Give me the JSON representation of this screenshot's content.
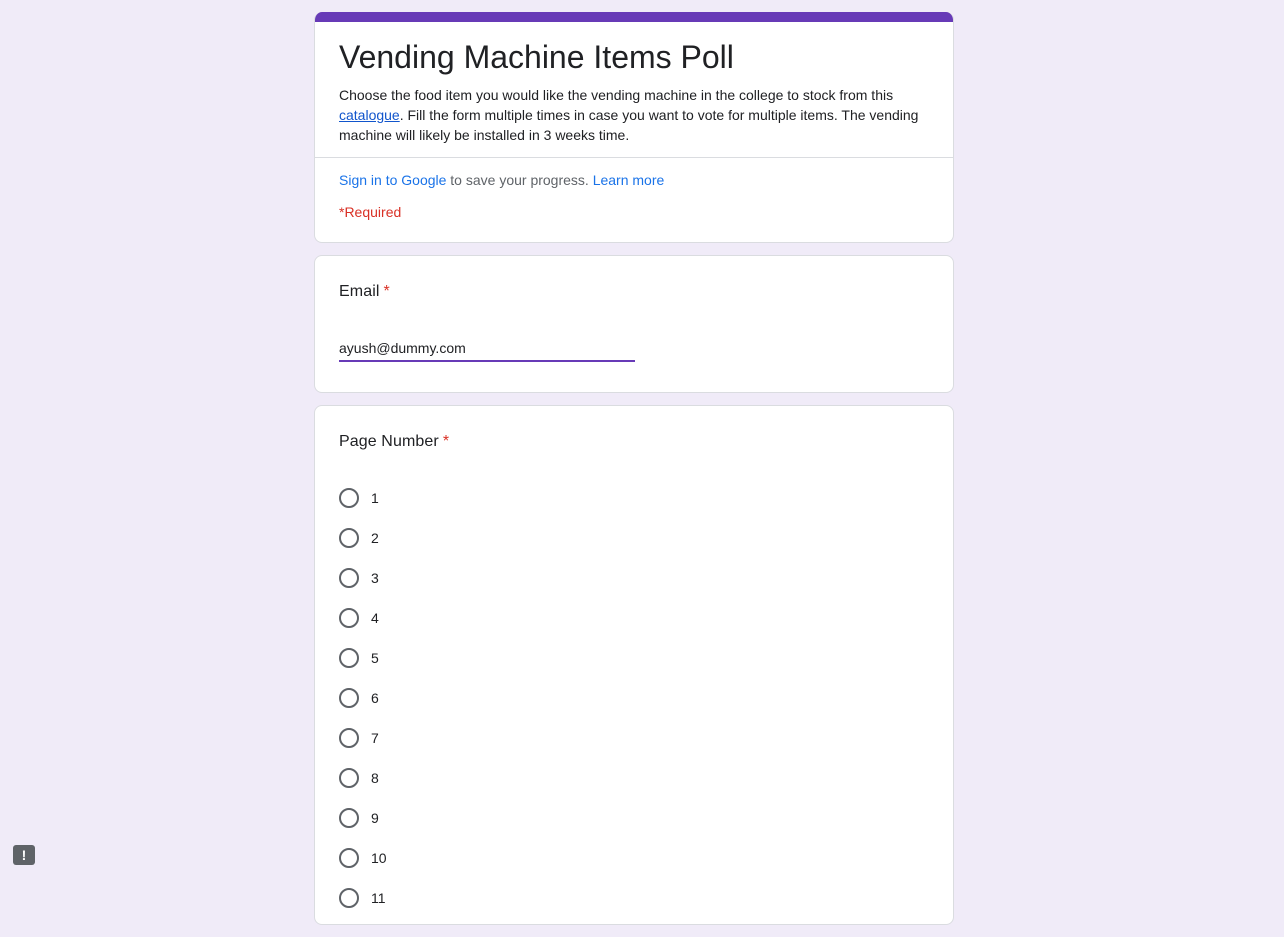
{
  "form": {
    "title": "Vending Machine Items Poll",
    "description_before_link": "Choose the food item you would like the vending machine in the college to stock from this ",
    "description_link": "catalogue",
    "description_after_link": ". Fill the form multiple times in case you want to vote for multiple items. The vending machine will likely be installed in 3 weeks time.",
    "sign_in_link": "Sign in to Google",
    "sign_in_text": " to save your progress. ",
    "learn_more": "Learn more",
    "required_note": "*Required"
  },
  "email_question": {
    "title": "Email",
    "required_marker": "*",
    "value": "ayush@dummy.com"
  },
  "page_question": {
    "title": "Page Number",
    "required_marker": "*",
    "options": [
      "1",
      "2",
      "3",
      "4",
      "5",
      "6",
      "7",
      "8",
      "9",
      "10",
      "11"
    ]
  },
  "colors": {
    "accent": "#673ab7",
    "background": "#f0ebf8",
    "required": "#d93025",
    "link": "#1a73e8"
  },
  "icons": {
    "report": "report-problem-icon"
  },
  "report_button": {
    "symbol": "!"
  }
}
